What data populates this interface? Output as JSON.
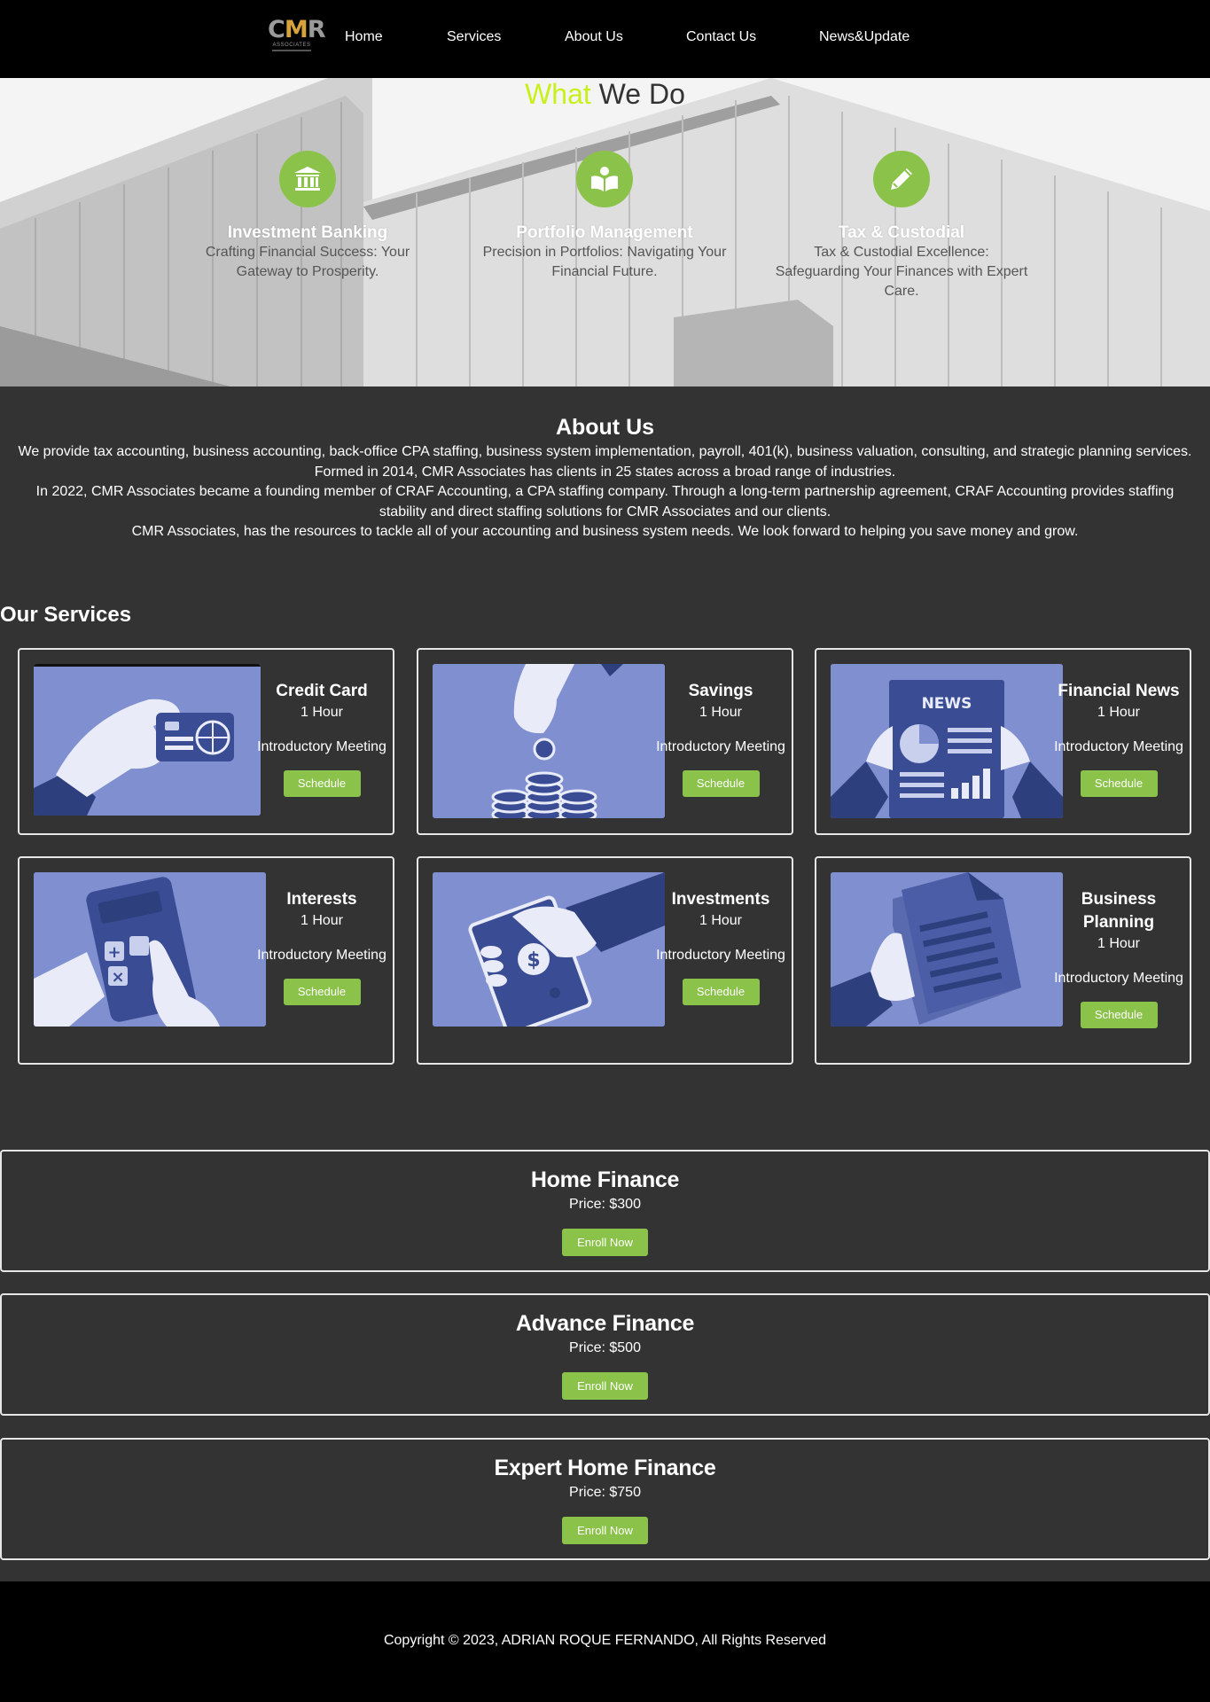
{
  "nav": {
    "logo_text": "CMR",
    "logo_sub": "ASSOCIATES",
    "items": [
      "Home",
      "Services",
      "About Us",
      "Contact Us",
      "News&Update"
    ]
  },
  "hero": {
    "title_highlight": "What",
    "title_rest": " We Do",
    "features": [
      {
        "icon": "bank-icon",
        "title": "Investment Banking",
        "text": "Crafting Financial Success: Your Gateway to Prosperity."
      },
      {
        "icon": "book-reader-icon",
        "title": "Portfolio Management",
        "text": "Precision in Portfolios: Navigating Your Financial Future."
      },
      {
        "icon": "pencil-icon",
        "title": "Tax & Custodial",
        "text": "Tax & Custodial Excellence: Safeguarding Your Finances with Expert Care."
      }
    ]
  },
  "about": {
    "title": "About Us",
    "p1": "We provide tax accounting, business accounting, back-office CPA staffing, business system implementation, payroll, 401(k), business valuation, consulting, and strategic planning services.",
    "p2": "Formed in 2014, CMR Associates has clients in 25 states across a broad range of industries.",
    "p3": "In 2022, CMR Associates became a founding member of CRAF Accounting, a CPA staffing company. Through a long-term partnership agreement, CRAF Accounting provides staffing stability and direct staffing solutions for CMR Associates and our clients.",
    "p4": "CMR Associates, has the resources to tackle all of your accounting and business system needs. We look forward to helping you save money and grow."
  },
  "services": {
    "title": "Our Services",
    "items": [
      {
        "title": "Credit Card",
        "duration": "1 Hour",
        "meeting": "Introductory Meeting",
        "button": "Schedule",
        "image": "credit-card-illustration"
      },
      {
        "title": "Savings",
        "duration": "1 Hour",
        "meeting": "Introductory Meeting",
        "button": "Schedule",
        "image": "savings-coins-illustration"
      },
      {
        "title": "Financial News",
        "duration": "1 Hour",
        "meeting": "Introductory Meeting",
        "button": "Schedule",
        "image": "newspaper-illustration",
        "news_label": "NEWS"
      },
      {
        "title": "Interests",
        "duration": "1 Hour",
        "meeting": "Introductory Meeting",
        "button": "Schedule",
        "image": "calculator-illustration"
      },
      {
        "title": "Investments",
        "duration": "1 Hour",
        "meeting": "Introductory Meeting",
        "button": "Schedule",
        "image": "cash-hand-illustration"
      },
      {
        "title": "Business Planning",
        "duration": "1 Hour",
        "meeting": "Introductory Meeting",
        "button": "Schedule",
        "image": "document-illustration"
      }
    ]
  },
  "pricing": [
    {
      "title": "Home Finance",
      "price": "Price: $300",
      "button": "Enroll Now"
    },
    {
      "title": "Advance Finance",
      "price": "Price: $500",
      "button": "Enroll Now"
    },
    {
      "title": "Expert Home Finance",
      "price": "Price: $750",
      "button": "Enroll Now"
    }
  ],
  "footer": {
    "copyright": "Copyright © 2023, ADRIAN ROQUE FERNANDO, All Rights Reserved"
  },
  "colors": {
    "accent_green": "#8bc34a",
    "title_highlight": "#c8f11b",
    "background": "#333333",
    "nav_bg": "#000000",
    "illustration_blue": "#7f8fd0"
  }
}
